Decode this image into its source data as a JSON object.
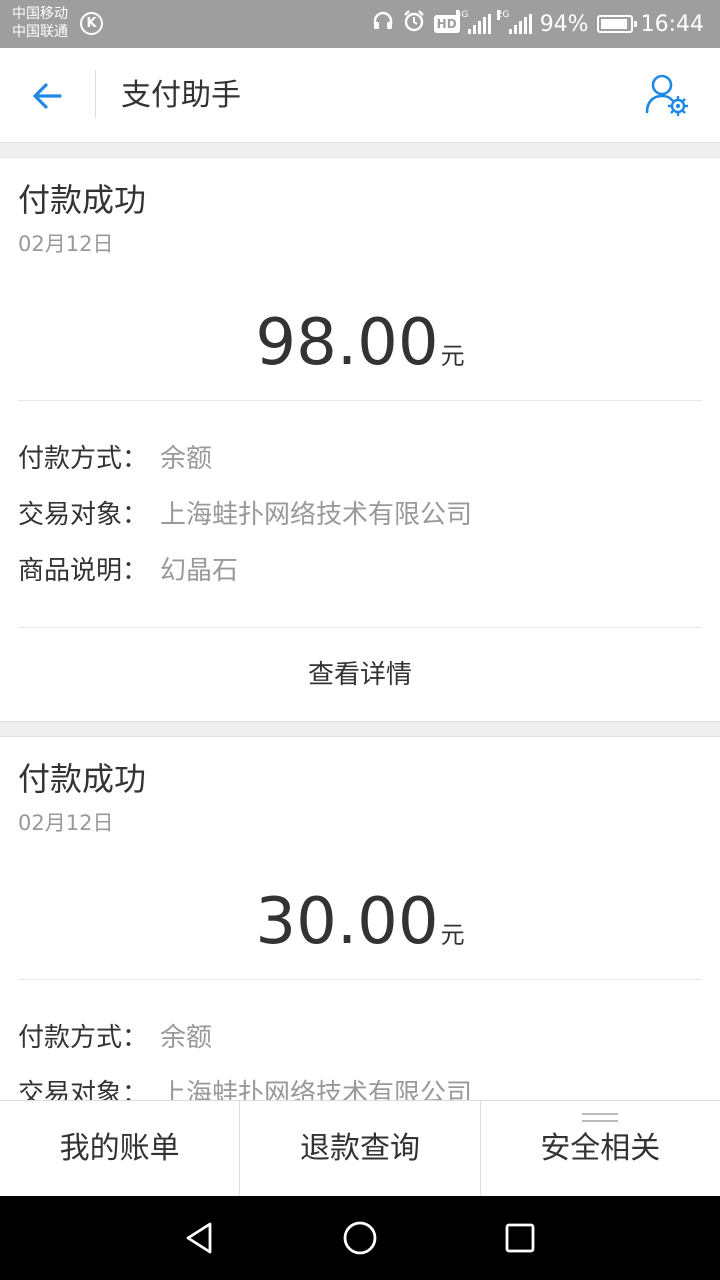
{
  "status_bar": {
    "carrier_1": "中国移动",
    "carrier_2": "中国联通",
    "k_badge": "K",
    "hd_badge": "HD",
    "net_1": "4G",
    "net_2": "2G",
    "battery_percent": "94%",
    "battery_level": 0.94,
    "time": "16:44",
    "icons": [
      "headset-icon",
      "alarm-icon",
      "hd-icon",
      "signal-icon",
      "signal-icon",
      "battery-icon"
    ]
  },
  "header": {
    "title": "支付助手",
    "back_icon": "arrow-left-icon",
    "settings_icon": "user-settings-icon",
    "accent_color": "#1e88e5"
  },
  "cards": [
    {
      "status": "付款成功",
      "date": "02月12日",
      "amount": "98.00",
      "unit": "元",
      "fields": [
        {
          "label": "付款方式",
          "value": "余额"
        },
        {
          "label": "交易对象",
          "value": "上海蛙扑网络技术有限公司"
        },
        {
          "label": "商品说明",
          "value": "幻晶石"
        }
      ],
      "details_label": "查看详情"
    },
    {
      "status": "付款成功",
      "date": "02月12日",
      "amount": "30.00",
      "unit": "元",
      "fields": [
        {
          "label": "付款方式",
          "value": "余额"
        },
        {
          "label": "交易对象",
          "value": "上海蛙扑网络技术有限公司"
        }
      ]
    }
  ],
  "colon": "：",
  "bottom_nav": {
    "items": [
      {
        "label": "我的账单"
      },
      {
        "label": "退款查询"
      },
      {
        "label": "安全相关"
      }
    ]
  },
  "system_nav": [
    "back-triangle-icon",
    "home-circle-icon",
    "recent-square-icon"
  ]
}
